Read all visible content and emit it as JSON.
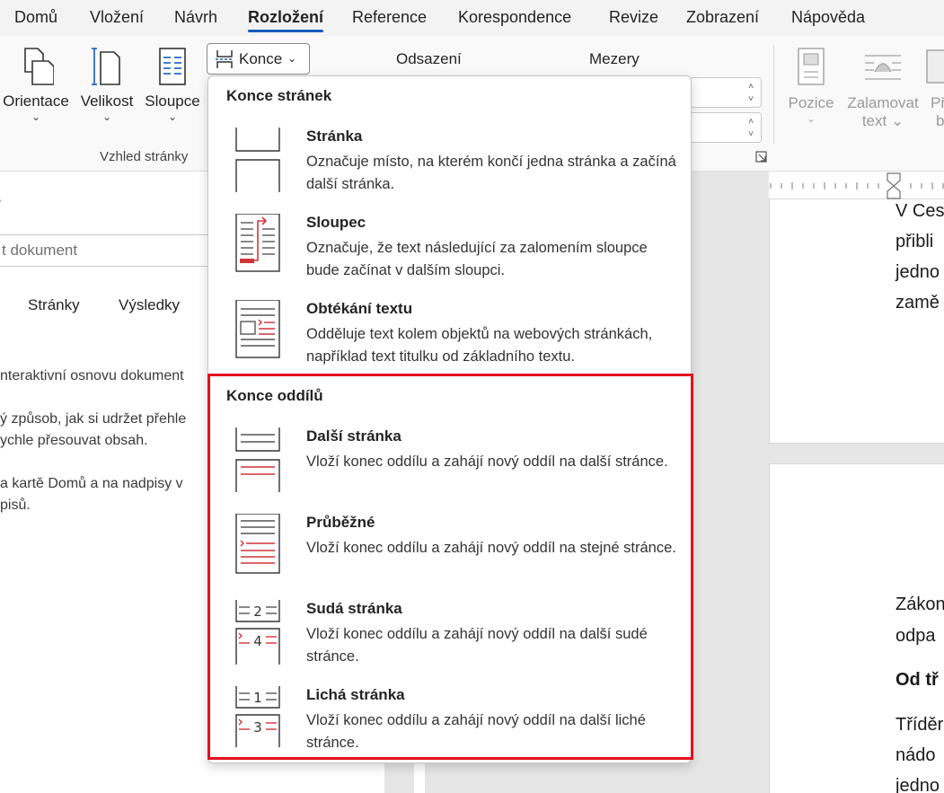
{
  "menu": {
    "tabs": [
      "Domů",
      "Vložení",
      "Návrh",
      "Rozložení",
      "Reference",
      "Korespondence",
      "Revize",
      "Zobrazení",
      "Nápověda"
    ],
    "active_index": 3,
    "accent_color": "#185abd"
  },
  "ribbon": {
    "orientace": "Orientace",
    "velikost": "Velikost",
    "sloupce": "Sloupce",
    "konce": "Konce",
    "group_label": "Vzhled stránky",
    "odsazeni": "Odsazení",
    "mezery": "Mezery",
    "pozice": "Pozice",
    "zalamovat_line1": "Zalamovat",
    "zalamovat_line2": "text",
    "cut_label_line1": "Př",
    "cut_label_line2": "b"
  },
  "nav": {
    "title": "e",
    "search_placeholder": "t dokument",
    "tabs": [
      "Stránky",
      "Výsledky"
    ],
    "text_lines": [
      "nteraktivní osnovu dokument",
      "ý způsob, jak si udržet přehle",
      "ychle přesouvat obsah.",
      "a kartě Domů a na nadpisy v",
      "pisů."
    ]
  },
  "doc": {
    "lines_top": [
      "V Ces",
      "přibli",
      "jedno",
      "zamě"
    ],
    "lines_bottom": [
      "Zákon",
      "odpa"
    ],
    "heading": "Od tř",
    "lines_after": [
      "Tříděr",
      "nádo",
      "jedno"
    ]
  },
  "dropdown": {
    "section1": "Konce stránek",
    "section2": "Konce oddílů",
    "highlight_color": "#e2111d",
    "items": [
      {
        "title": "Stránka",
        "desc": "Označuje místo, na kterém končí jedna stránka a začíná další stránka.",
        "icon": "page-break-icon"
      },
      {
        "title": "Sloupec",
        "desc": "Označuje, že text následující za zalomením sloupce bude začínat v dalším sloupci.",
        "icon": "column-break-icon"
      },
      {
        "title": "Obtékání textu",
        "desc": "Odděluje text kolem objektů na webových stránkách, například text titulku od základního textu.",
        "icon": "text-wrapping-break-icon"
      },
      {
        "title": "Další stránka",
        "desc": "Vloží konec oddílu a zahájí nový oddíl na další stránce.",
        "icon": "next-page-break-icon"
      },
      {
        "title": "Průběžné",
        "desc": "Vloží konec oddílu a zahájí nový oddíl na stejné stránce.",
        "icon": "continuous-break-icon"
      },
      {
        "title": "Sudá stránka",
        "desc": "Vloží konec oddílu a zahájí nový oddíl na další sudé stránce.",
        "icon": "even-page-break-icon"
      },
      {
        "title": "Lichá stránka",
        "desc": "Vloží konec oddílu a zahájí nový oddíl na další liché stránce.",
        "icon": "odd-page-break-icon"
      }
    ]
  }
}
